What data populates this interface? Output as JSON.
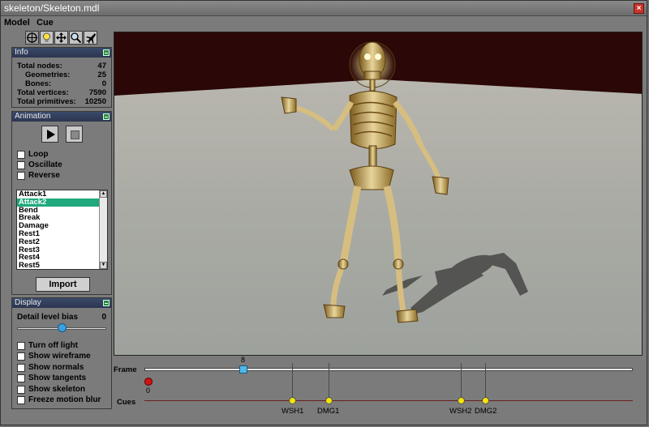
{
  "window": {
    "title": "skeleton/Skeleton.mdl",
    "close_label": "×"
  },
  "menu": [
    "Model",
    "Cue"
  ],
  "toolbar": {
    "icons": [
      "orbit-icon",
      "light-icon",
      "move-icon",
      "zoom-icon",
      "fly-icon"
    ],
    "active_index": 0
  },
  "info": {
    "header": "Info",
    "rows": [
      {
        "label": "Total nodes:",
        "value": "47"
      },
      {
        "label": "Geometries:",
        "value": "25"
      },
      {
        "label": "Bones:",
        "value": "0"
      },
      {
        "label": "Total vertices:",
        "value": "7590"
      },
      {
        "label": "Total primitives:",
        "value": "10250"
      }
    ]
  },
  "animation": {
    "header": "Animation",
    "options": [
      "Loop",
      "Oscillate",
      "Reverse"
    ],
    "list": [
      "Attack1",
      "Attack2",
      "Bend",
      "Break",
      "Damage",
      "Rest1",
      "Rest2",
      "Rest3",
      "Rest4",
      "Rest5"
    ],
    "selected_index": 1,
    "scroll_up": "▲",
    "scroll_down": "▼",
    "import_label": "Import"
  },
  "display": {
    "header": "Display",
    "detail_label": "Detail level bias",
    "detail_value": "0",
    "detail_fraction": 0.5,
    "options": [
      "Turn off light",
      "Show wireframe",
      "Show normals",
      "Show tangents",
      "Show skeleton",
      "Freeze motion blur"
    ]
  },
  "timeline": {
    "frame_label": "Frame",
    "cues_label": "Cues",
    "current_frame": "8",
    "start_frame": "0",
    "cues": [
      "WSH1",
      "DMG1",
      "WSH2",
      "DMG2"
    ]
  },
  "colors": {
    "selection": "#1fa97c",
    "cue_marker": "#f3e600",
    "start_marker": "#d21212"
  }
}
